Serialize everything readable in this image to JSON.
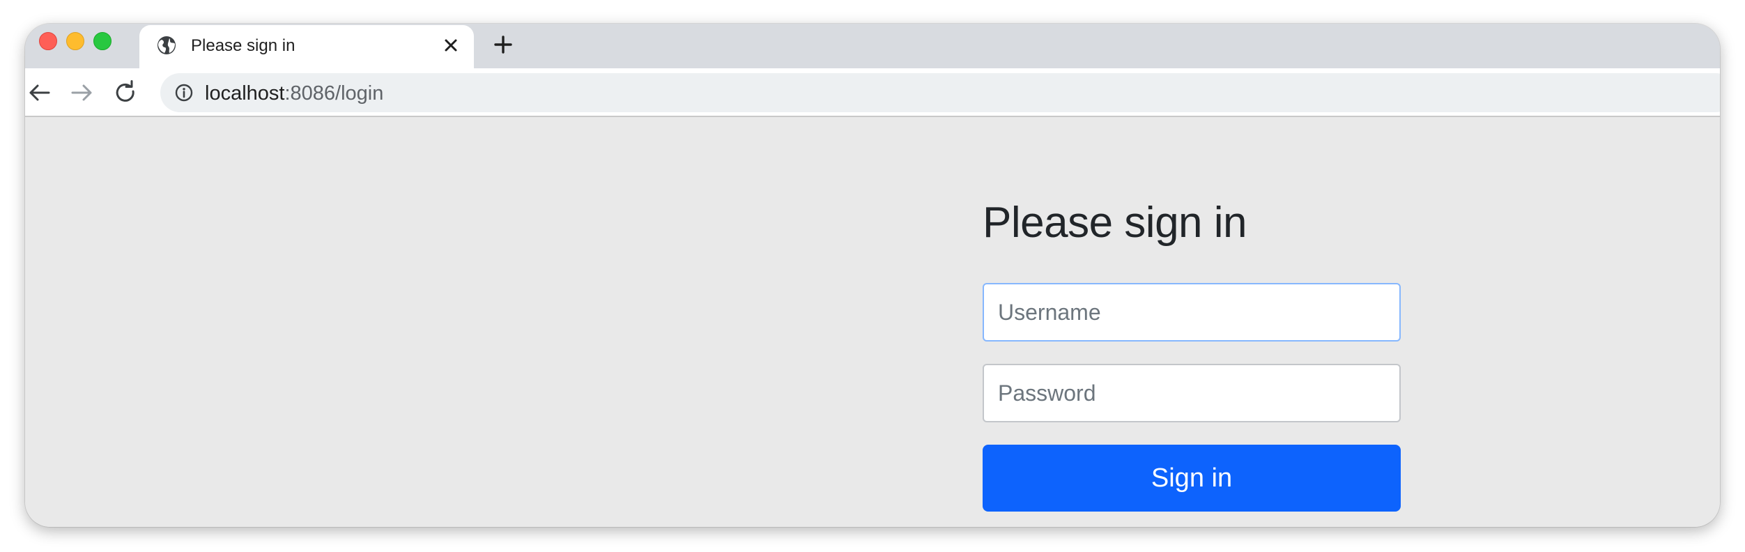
{
  "browser": {
    "tab": {
      "title": "Please sign in",
      "icon": "globe-icon"
    },
    "address": {
      "host": "localhost",
      "rest": ":8086/login",
      "icon": "info-icon"
    },
    "colors": {
      "close": "#fe5f57",
      "minimize": "#febc2e",
      "maximize": "#28c840",
      "titlebar": "#d8dbe0"
    }
  },
  "login": {
    "heading": "Please sign in",
    "username_placeholder": "Username",
    "password_placeholder": "Password",
    "submit_label": "Sign in",
    "accent_color": "#0d63fd"
  }
}
